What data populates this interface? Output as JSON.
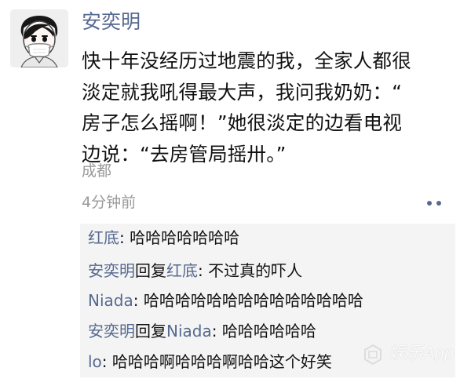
{
  "post": {
    "author": "安奕明",
    "text_lines": [
      "快十年没经历过地震的我，全家人都很",
      "淡定就我吼得最大声，我问我奶奶：“",
      "房子怎么摇啊！”她很淡定的边看电视",
      "边说：“去房管局摇卅。”"
    ],
    "location": "成都",
    "time": "4分钟前",
    "more_icon": "more-dots-icon",
    "avatar_icon": "avatar-mask-icon"
  },
  "comments": [
    {
      "name": "红底",
      "text": ": 哈哈哈哈哈哈哈"
    },
    {
      "name": "安奕明",
      "reply_word": "回复",
      "reply_to": "红底",
      "text": ": 不过真的吓人"
    },
    {
      "name": "Niada",
      "text": ": 哈哈哈哈哈哈哈哈哈哈哈哈哈哈"
    },
    {
      "name": "安奕明",
      "reply_word": "回复",
      "reply_to": "Niada",
      "text": ": 哈哈哈哈哈哈"
    },
    {
      "name": "lo",
      "text": ": 哈哈哈啊哈哈哈啊哈哈这个好笑"
    }
  ],
  "watermark": {
    "text": "娱乐App"
  },
  "colors": {
    "name_blue": "#56698f",
    "secondary_gray": "#9a9a9a",
    "comment_bg": "#f4f4f4"
  }
}
